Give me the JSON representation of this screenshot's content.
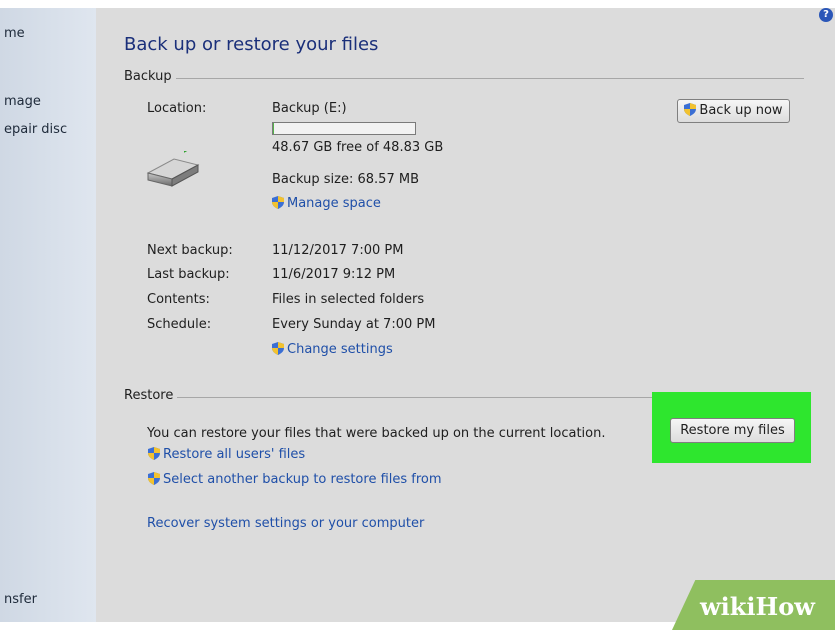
{
  "sidebar": {
    "items": [
      "me",
      "mage",
      "epair disc",
      "nsfer"
    ]
  },
  "main": {
    "title": "Back up or restore your files",
    "backup": {
      "section_label": "Backup",
      "location_label": "Location:",
      "location_value": "Backup (E:)",
      "space_used_fraction": 0.003,
      "free_space": "48.67 GB free of 48.83 GB",
      "backup_size": "Backup size: 68.57 MB",
      "manage_space_link": "Manage space",
      "back_up_now_button": "Back up now",
      "next_backup_label": "Next backup:",
      "next_backup_value": "11/12/2017 7:00 PM",
      "last_backup_label": "Last backup:",
      "last_backup_value": "11/6/2017 9:12 PM",
      "contents_label": "Contents:",
      "contents_value": "Files in selected folders",
      "schedule_label": "Schedule:",
      "schedule_value": "Every Sunday at 7:00 PM",
      "change_settings_link": "Change settings"
    },
    "restore": {
      "section_label": "Restore",
      "description": "You can restore your files that were backed up on the current location.",
      "restore_my_files_button": "Restore my files",
      "restore_all_users_link": "Restore all users' files",
      "select_another_backup_link": "Select another backup to restore files from",
      "recover_link": "Recover system settings or your computer"
    }
  },
  "watermark": {
    "part1": "wiki",
    "part2": "How"
  },
  "colors": {
    "highlight": "#2ee62e",
    "link": "#1f4fa8",
    "title": "#1a2f7a"
  }
}
